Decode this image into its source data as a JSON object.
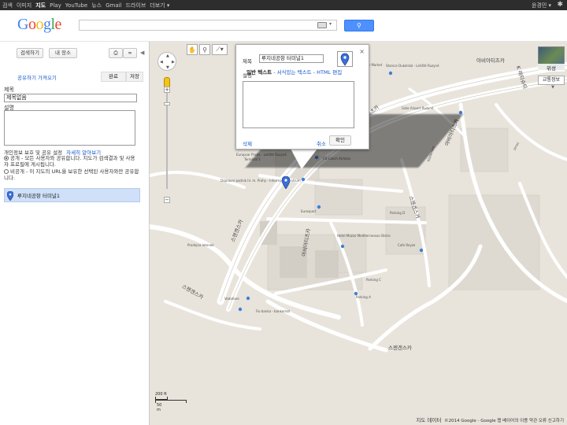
{
  "gbar": {
    "links": [
      {
        "label": "검색",
        "active": false
      },
      {
        "label": "이미지",
        "active": false
      },
      {
        "label": "지도",
        "active": true
      },
      {
        "label": "Play",
        "active": false
      },
      {
        "label": "YouTube",
        "active": false
      },
      {
        "label": "뉴스",
        "active": false
      },
      {
        "label": "Gmail",
        "active": false
      },
      {
        "label": "드라이브",
        "active": false
      },
      {
        "label": "더보기 ▾",
        "active": false
      }
    ],
    "user": "윤경민 ▾"
  },
  "header": {
    "logo": "Google",
    "search": {
      "value": "",
      "placeholder": ""
    },
    "logo_colors": [
      "#4285f4",
      "#ea4335",
      "#fbbc05",
      "#4285f4",
      "#34a853",
      "#ea4335"
    ],
    "search_button_icon": "search-icon"
  },
  "panel": {
    "search_button": "검색하기",
    "my_places_button": "내 장소",
    "share_link": "공유하기 가져오기",
    "done_tab": "완료",
    "save_tab": "저장",
    "title_label": "제목",
    "title_value": "제목없음",
    "desc_label": "설명",
    "privacy_text": "개인정보 보호 및 공유 설정",
    "privacy_link": "자세히 알아보기",
    "public_option": "공개 - 모든 사용자와 공유합니다. 지도가 검색결과 및 사용자 프로필에 게시됩니다.",
    "private_option": "비공개 - 이 지도의 URL을 보유한 선택된 사용자와만 공유합니다.",
    "placemark_name": "루지네공항 터미널1"
  },
  "map": {
    "streets": [
      "아비아티츠카",
      "아비아티츠카",
      "스젠겐스카",
      "스젠겐스카",
      "스젠겐스카",
      "스젠겐스카",
      "아비아티츠카",
      "K 레티슈티",
      "아비아티츠카"
    ],
    "pois": [
      "Europcar Praha - Letiště Ruzyně",
      "Terminal 1",
      "Dopravní podnik hl. m. Prahy - Informační centrum",
      "CS-Czech Airlines",
      "Eurosport",
      "Hotel Mazzo Mediterranean Bistro",
      "Parking C",
      "Parking A",
      "Vodafone",
      "Fio banka - bankomat",
      "Prodejna letenek",
      "Penny Market",
      "Cafe Reyze",
      "Gate Airport Ruzyně",
      "Stanice Dukelská - Letiště Ruzyně",
      "Kladenská",
      "Parking D",
      "Jeneč"
    ],
    "scale_top": "200 ft",
    "scale_bottom": "50 m",
    "footer_data": "지도 데이터",
    "footer_copyright": "©2014 Google - Google 맵 베이어의 이용 약관",
    "footer_report": "오류 신고하기",
    "satellite_label": "위성",
    "traffic_label": "교통정보",
    "road_color": "#ffffff",
    "bg_color": "#e8e4dc"
  },
  "infowindow": {
    "title_label": "제목",
    "title_value": "루지네공항 터미널1",
    "desc_label": "설명",
    "mode_plain": "일반 텍스트",
    "mode_rich": "서식있는 텍스트",
    "mode_html": "HTML 편집",
    "delete": "삭제",
    "cancel": "취소",
    "ok": "확인",
    "close": "×"
  }
}
